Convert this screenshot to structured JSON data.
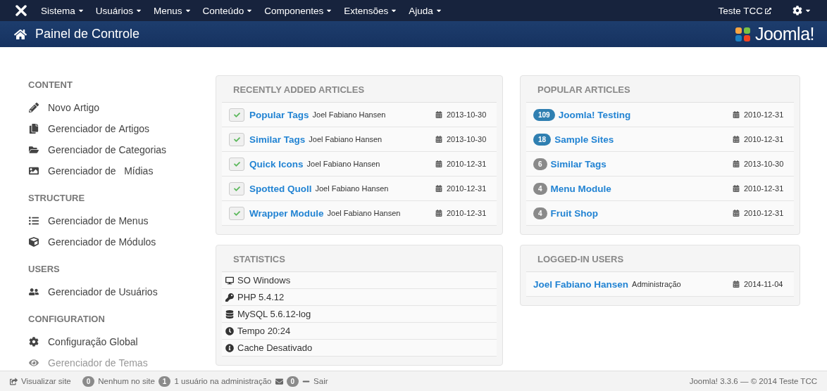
{
  "navbar": {
    "menus": [
      {
        "label": "Sistema"
      },
      {
        "label": "Usuários"
      },
      {
        "label": "Menus"
      },
      {
        "label": "Conteúdo"
      },
      {
        "label": "Componentes"
      },
      {
        "label": "Extensões"
      },
      {
        "label": "Ajuda"
      }
    ],
    "site_link": "Teste TCC"
  },
  "header": {
    "title": "Painel de Controle",
    "logo_text": "Joomla!"
  },
  "sidebar": {
    "sections": [
      {
        "heading": "CONTENT",
        "items": [
          {
            "label": "Novo Artigo",
            "disabled": false
          },
          {
            "label": "Gerenciador de Artigos",
            "disabled": false
          },
          {
            "label": "Gerenciador de Categorias",
            "disabled": false
          },
          {
            "label": "Gerenciador de   Mídias",
            "disabled": false
          }
        ]
      },
      {
        "heading": "STRUCTURE",
        "items": [
          {
            "label": "Gerenciador de Menus",
            "disabled": false
          },
          {
            "label": "Gerenciador de Módulos",
            "disabled": false
          }
        ]
      },
      {
        "heading": "USERS",
        "items": [
          {
            "label": "Gerenciador de Usuários",
            "disabled": false
          }
        ]
      },
      {
        "heading": "CONFIGURATION",
        "items": [
          {
            "label": "Configuração Global",
            "disabled": false
          },
          {
            "label": "Gerenciador de Temas",
            "disabled": true
          }
        ]
      }
    ]
  },
  "recent_articles": {
    "title": "RECENTLY ADDED ARTICLES",
    "rows": [
      {
        "title": "Popular Tags",
        "author": "Joel Fabiano Hansen",
        "date": "2013-10-30",
        "published": true
      },
      {
        "title": "Similar Tags",
        "author": "Joel Fabiano Hansen",
        "date": "2013-10-30",
        "published": true
      },
      {
        "title": "Quick Icons",
        "author": "Joel Fabiano Hansen",
        "date": "2010-12-31",
        "published": true
      },
      {
        "title": "Spotted Quoll",
        "author": "Joel Fabiano Hansen",
        "date": "2010-12-31",
        "published": true
      },
      {
        "title": "Wrapper Module",
        "author": "Joel Fabiano Hansen",
        "date": "2010-12-31",
        "published": true
      }
    ]
  },
  "popular_articles": {
    "title": "POPULAR ARTICLES",
    "rows": [
      {
        "hits": "109",
        "title": "Joomla! Testing",
        "date": "2010-12-31",
        "color": "#2f7fb1"
      },
      {
        "hits": "18",
        "title": "Sample Sites",
        "date": "2010-12-31",
        "color": "#2f7fb1"
      },
      {
        "hits": "6",
        "title": "Similar Tags",
        "date": "2013-10-30",
        "color": "#8a8a8a"
      },
      {
        "hits": "4",
        "title": "Menu Module",
        "date": "2010-12-31",
        "color": "#8a8a8a"
      },
      {
        "hits": "4",
        "title": "Fruit Shop",
        "date": "2010-12-31",
        "color": "#8a8a8a"
      }
    ]
  },
  "statistics": {
    "title": "STATISTICS",
    "rows": [
      {
        "text": "SO Windows"
      },
      {
        "text": "PHP 5.4.12"
      },
      {
        "text": "MySQL 5.6.12-log"
      },
      {
        "text": "Tempo 20:24"
      },
      {
        "text": "Cache Desativado"
      }
    ]
  },
  "logged_in_users": {
    "title": "LOGGED-IN USERS",
    "rows": [
      {
        "name": "Joel Fabiano Hansen",
        "role": "Administração",
        "date": "2014-11-04"
      }
    ]
  },
  "status_bar": {
    "view_site": "Visualizar site",
    "visitors_count": "0",
    "visitors_label": "Nenhum no site",
    "admins_count": "1",
    "admins_label": "1 usuário na administração",
    "messages_count": "0",
    "logout": "Sair",
    "version": "Joomla! 3.3.6 — © 2014 Teste TCC"
  }
}
